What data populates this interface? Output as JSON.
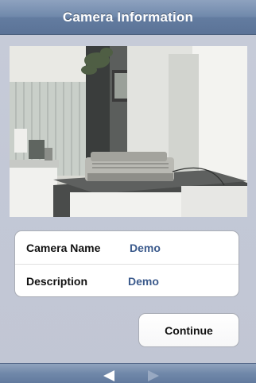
{
  "header": {
    "title": "Camera Information"
  },
  "preview": {
    "icon": "camera-preview-image"
  },
  "info": {
    "rows": [
      {
        "label": "Camera Name",
        "value": "Demo"
      },
      {
        "label": "Description",
        "value": "Demo"
      }
    ]
  },
  "actions": {
    "continue_label": "Continue"
  },
  "toolbar": {
    "back_icon": "arrow-left-icon",
    "forward_icon": "arrow-right-icon"
  },
  "colors": {
    "background": "#c3c8d6",
    "navbar": "#7089ab",
    "value_text": "#3b5a8c",
    "forward_disabled": "#98a9c2"
  }
}
